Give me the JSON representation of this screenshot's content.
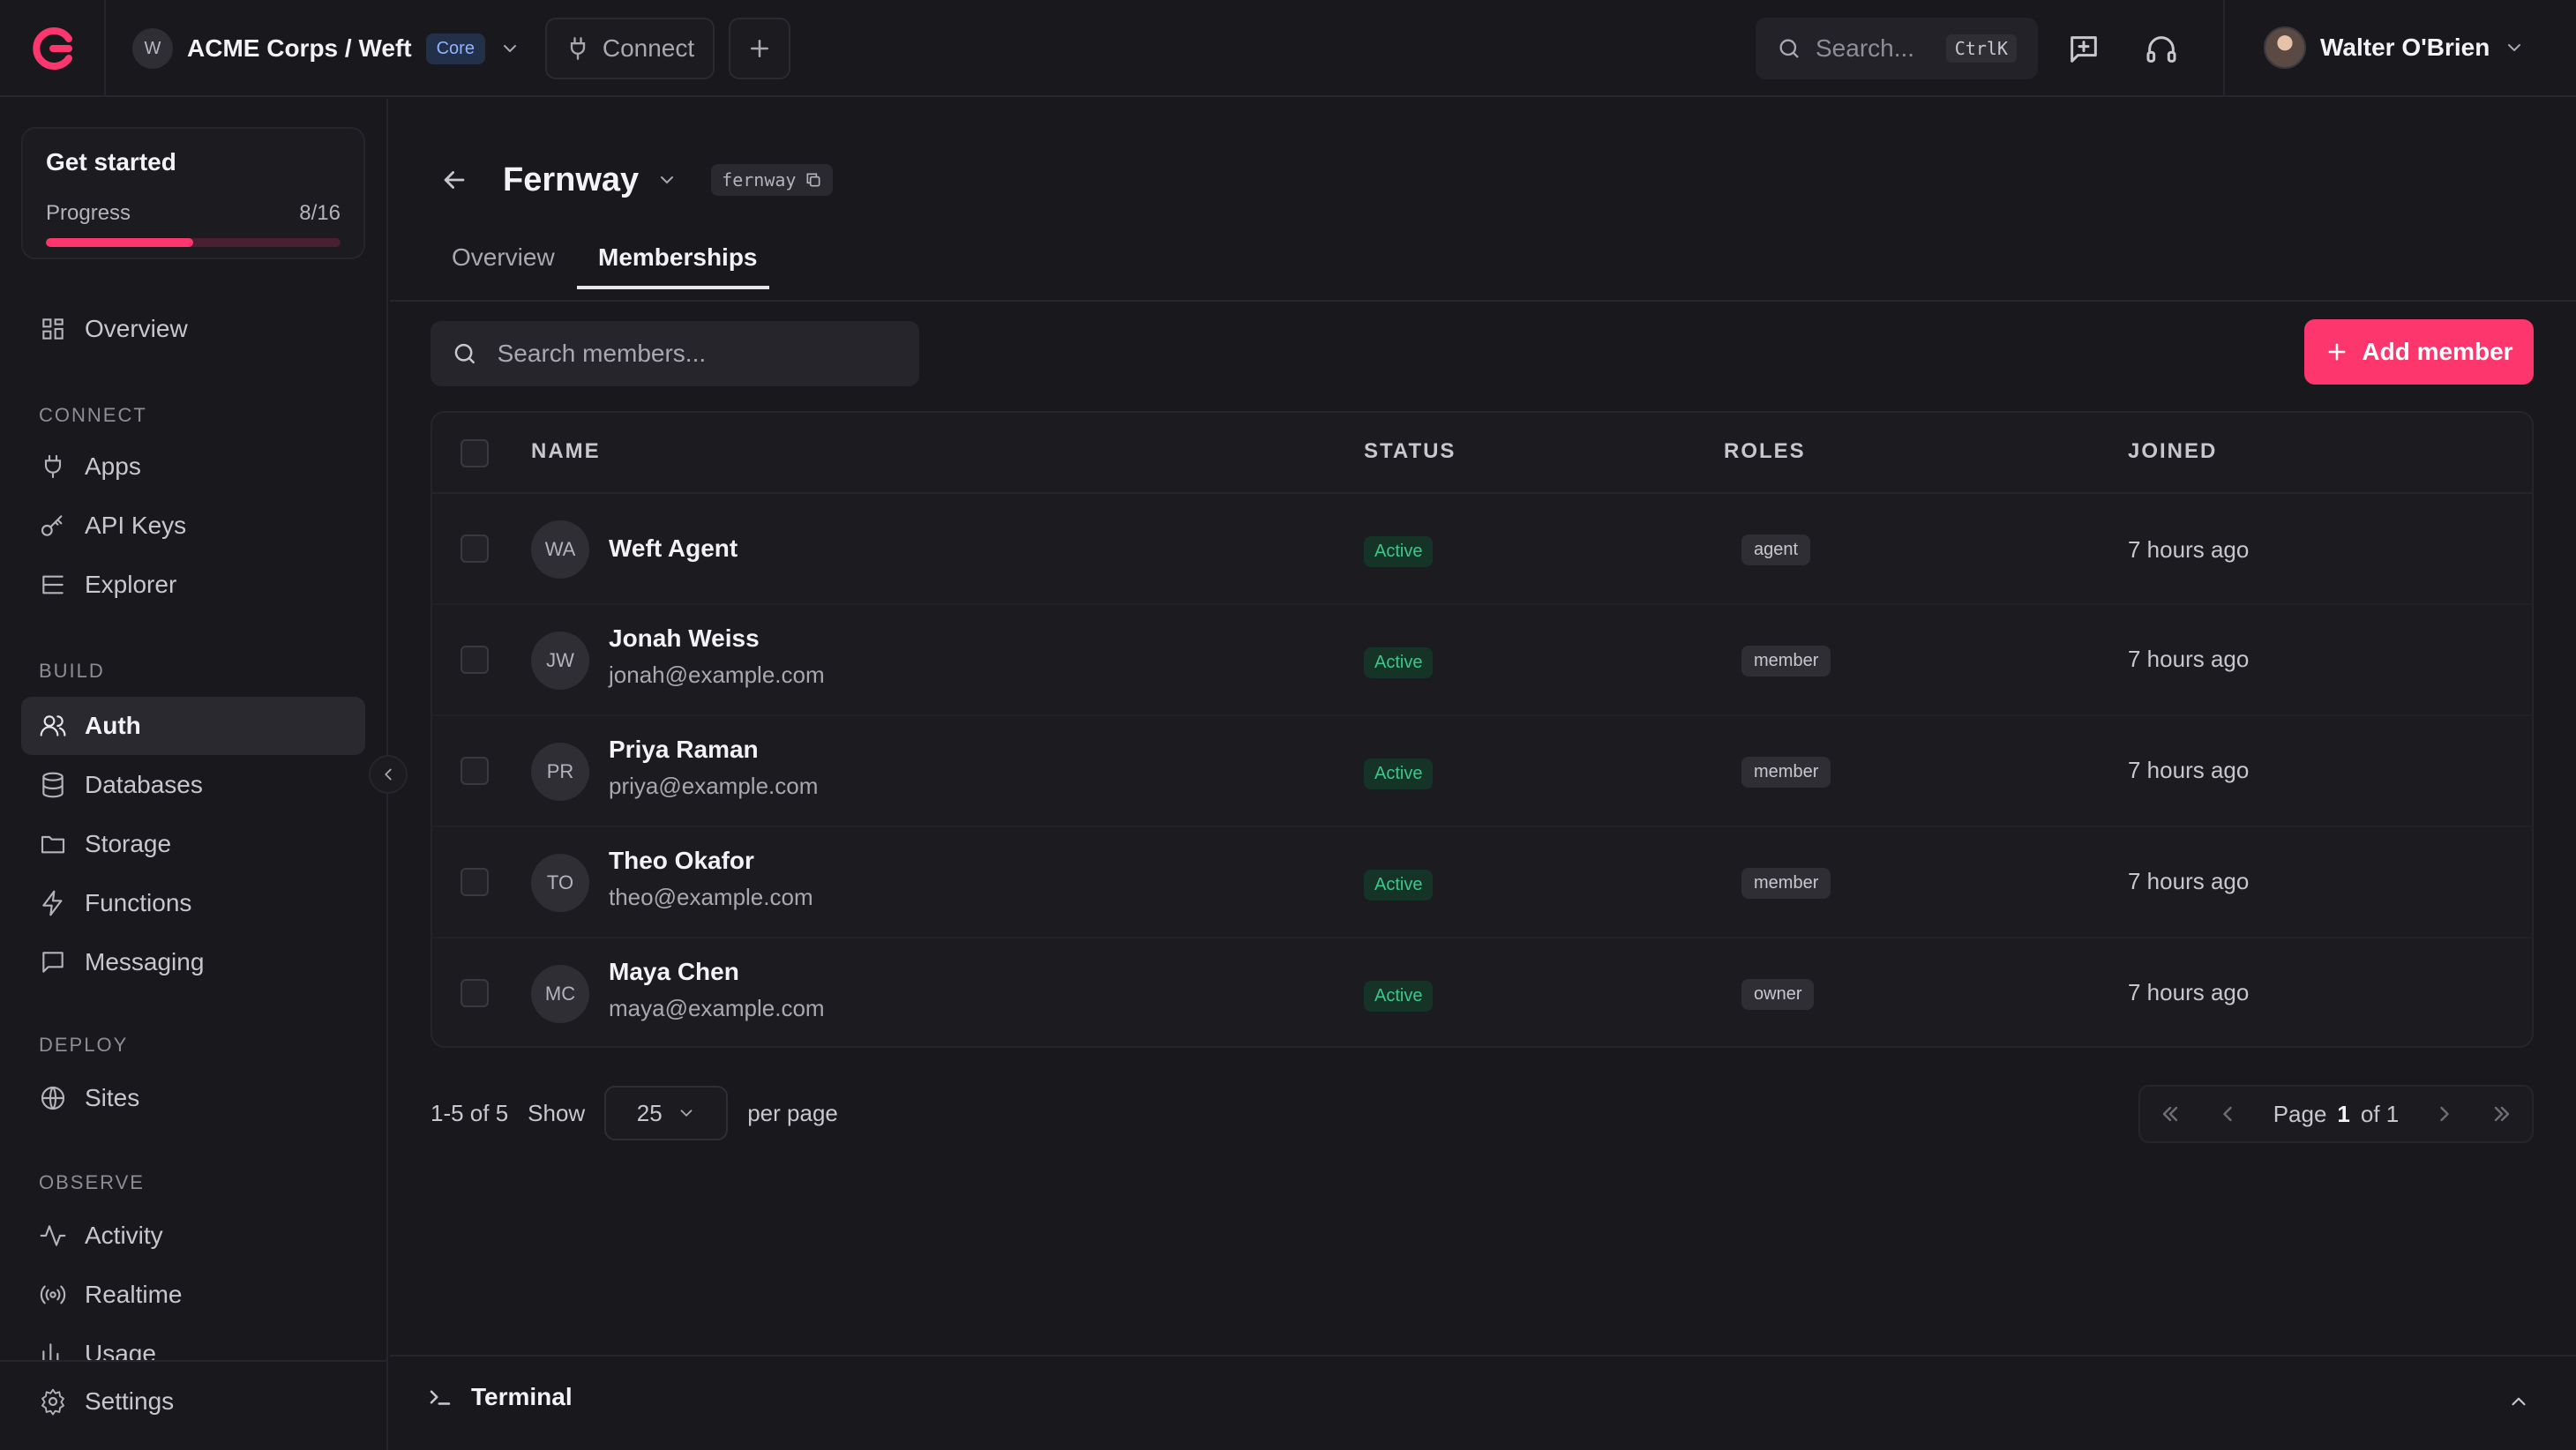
{
  "topbar": {
    "org_initial": "W",
    "org_name": "ACME Corps / Weft",
    "org_badge": "Core",
    "connect_label": "Connect",
    "search_placeholder": "Search...",
    "search_shortcut": "CtrlK",
    "user_name": "Walter O'Brien"
  },
  "sidebar": {
    "get_started": {
      "title": "Get started",
      "progress_label": "Progress",
      "progress_text": "8/16",
      "progress_fraction": 0.5
    },
    "overview": "Overview",
    "sections": {
      "connect": "CONNECT",
      "build": "BUILD",
      "deploy": "DEPLOY",
      "observe": "OBSERVE"
    },
    "items": {
      "apps": "Apps",
      "api_keys": "API Keys",
      "explorer": "Explorer",
      "auth": "Auth",
      "databases": "Databases",
      "storage": "Storage",
      "functions": "Functions",
      "messaging": "Messaging",
      "sites": "Sites",
      "activity": "Activity",
      "realtime": "Realtime",
      "usage": "Usage",
      "settings": "Settings"
    }
  },
  "page": {
    "title": "Fernway",
    "slug": "fernway",
    "tabs": [
      "Overview",
      "Memberships"
    ],
    "active_tab": "Memberships",
    "search_placeholder": "Search members...",
    "add_member_label": "Add member"
  },
  "table": {
    "columns": {
      "name": "NAME",
      "status": "STATUS",
      "roles": "ROLES",
      "joined": "JOINED"
    },
    "rows": [
      {
        "initials": "WA",
        "name": "Weft Agent",
        "email": "",
        "status": "Active",
        "role": "agent",
        "joined": "7 hours ago"
      },
      {
        "initials": "JW",
        "name": "Jonah Weiss",
        "email": "jonah@example.com",
        "status": "Active",
        "role": "member",
        "joined": "7 hours ago"
      },
      {
        "initials": "PR",
        "name": "Priya Raman",
        "email": "priya@example.com",
        "status": "Active",
        "role": "member",
        "joined": "7 hours ago"
      },
      {
        "initials": "TO",
        "name": "Theo Okafor",
        "email": "theo@example.com",
        "status": "Active",
        "role": "member",
        "joined": "7 hours ago"
      },
      {
        "initials": "MC",
        "name": "Maya Chen",
        "email": "maya@example.com",
        "status": "Active",
        "role": "owner",
        "joined": "7 hours ago"
      }
    ]
  },
  "pagination": {
    "range": "1-5 of 5",
    "show_label": "Show",
    "per_page_value": "25",
    "per_page_label": "per page",
    "page_label": "Page",
    "current_page": "1",
    "of_label": "of 1"
  },
  "terminal": {
    "label": "Terminal"
  },
  "colors": {
    "accent": "#fd366e",
    "background": "#19181d",
    "status_active": "#39c98b"
  }
}
